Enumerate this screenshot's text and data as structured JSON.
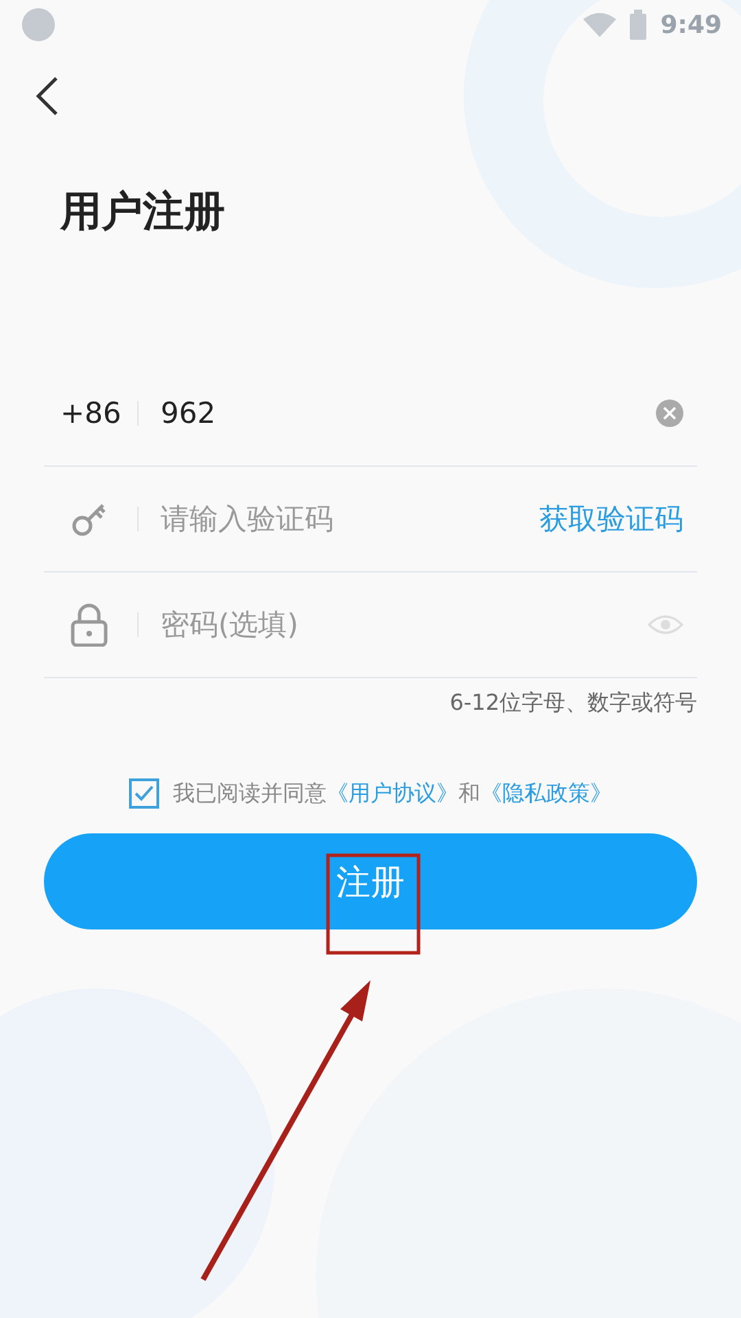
{
  "status_bar": {
    "time": "9:49"
  },
  "title": "用户注册",
  "phone": {
    "country_code": "+86",
    "value": "962"
  },
  "code": {
    "placeholder": "请输入验证码",
    "action": "获取验证码"
  },
  "password": {
    "placeholder": "密码(选填)",
    "hint": "6-12位字母、数字或符号"
  },
  "agreement": {
    "checked": true,
    "parts": [
      {
        "kind": "text",
        "text": "我已阅读并同意"
      },
      {
        "kind": "link",
        "text": "《用户协议》"
      },
      {
        "kind": "text",
        "text": "和"
      },
      {
        "kind": "link",
        "text": "《隐私政策》"
      }
    ]
  },
  "submit": {
    "label": "注册"
  }
}
